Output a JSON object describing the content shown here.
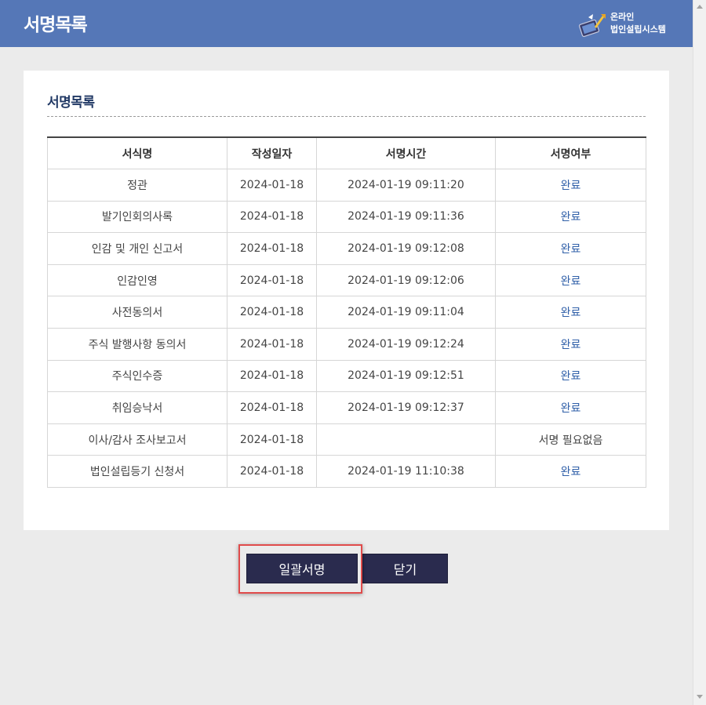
{
  "header": {
    "title": "서명목록",
    "brand_line1": "온라인",
    "brand_line2": "법인설립시스템",
    "color": "#5577b7"
  },
  "section": {
    "title": "서명목록"
  },
  "table": {
    "headers": [
      "서식명",
      "작성일자",
      "서명시간",
      "서명여부"
    ],
    "rows": [
      {
        "form": "정관",
        "date": "2024-01-18",
        "time": "2024-01-19 09:11:20",
        "status": "완료"
      },
      {
        "form": "발기인회의사록",
        "date": "2024-01-18",
        "time": "2024-01-19 09:11:36",
        "status": "완료"
      },
      {
        "form": "인감 및 개인 신고서",
        "date": "2024-01-18",
        "time": "2024-01-19 09:12:08",
        "status": "완료"
      },
      {
        "form": "인감인영",
        "date": "2024-01-18",
        "time": "2024-01-19 09:12:06",
        "status": "완료"
      },
      {
        "form": "사전동의서",
        "date": "2024-01-18",
        "time": "2024-01-19 09:11:04",
        "status": "완료"
      },
      {
        "form": "주식 발행사항 동의서",
        "date": "2024-01-18",
        "time": "2024-01-19 09:12:24",
        "status": "완료"
      },
      {
        "form": "주식인수증",
        "date": "2024-01-18",
        "time": "2024-01-19 09:12:51",
        "status": "완료"
      },
      {
        "form": "취임승낙서",
        "date": "2024-01-18",
        "time": "2024-01-19 09:12:37",
        "status": "완료"
      },
      {
        "form": "이사/감사 조사보고서",
        "date": "2024-01-18",
        "time": "",
        "status": "서명 필요없음"
      },
      {
        "form": "법인설립등기 신청서",
        "date": "2024-01-18",
        "time": "2024-01-19 11:10:38",
        "status": "완료"
      }
    ]
  },
  "buttons": {
    "sign_all": "일괄서명",
    "close": "닫기"
  }
}
